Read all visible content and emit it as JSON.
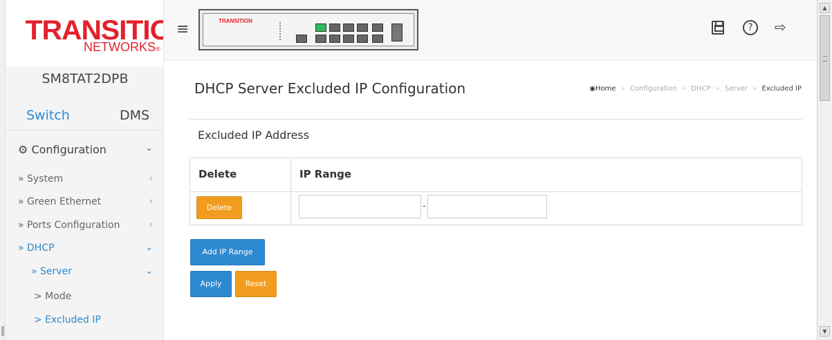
{
  "logo": {
    "main": "TRANSITION",
    "sub": "NETWORKS",
    "reg": "®"
  },
  "device": {
    "model": "SM8TAT2DPB",
    "image_brand": "TRANSITION"
  },
  "mode_tabs": {
    "switch": "Switch",
    "dms": "DMS"
  },
  "nav": {
    "configuration": "Configuration",
    "items": [
      {
        "label": "» System"
      },
      {
        "label": "» Green Ethernet"
      },
      {
        "label": "» Ports Configuration"
      },
      {
        "label": "» DHCP"
      },
      {
        "label": "» Server"
      },
      {
        "label": "> Mode"
      },
      {
        "label": "> Excluded IP"
      }
    ],
    "arrow_collapsed": "‹",
    "arrow_expanded": "⌄"
  },
  "header": {
    "title": "DHCP Server Excluded IP Configuration",
    "breadcrumb": [
      "Home",
      "Configuration",
      "DHCP",
      "Server",
      "Excluded IP"
    ],
    "breadcrumb_sep": "»"
  },
  "section": {
    "title": "Excluded IP Address"
  },
  "table": {
    "headers": {
      "delete": "Delete",
      "ip_range": "IP Range"
    },
    "rows": [
      {
        "delete_label": "Delete",
        "start_ip": "",
        "end_ip": "",
        "sep": "-"
      }
    ]
  },
  "buttons": {
    "add": "Add IP Range",
    "apply": "Apply",
    "reset": "Reset"
  },
  "toolbar": {
    "help": "?",
    "logout": "⇨"
  },
  "colors": {
    "brand_red": "#e3212d",
    "accent_blue": "#2e8ad0",
    "orange": "#f29c1f",
    "port_up": "#2fb95e"
  }
}
